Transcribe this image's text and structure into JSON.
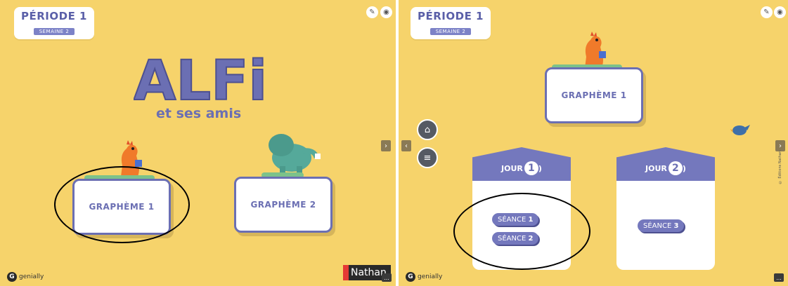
{
  "left": {
    "period_title": "PÉRIODE 1",
    "period_week": "SEMAINE 2",
    "logo_main": "ALFi",
    "logo_sub": "et ses amis",
    "card1": {
      "word": "GRAPHÈME",
      "num": "1"
    },
    "card2": {
      "word": "GRAPHÈME",
      "num": "2"
    },
    "genially": "genially",
    "publisher": "Nathan",
    "more": "...",
    "next_arrow": "›"
  },
  "right": {
    "period_title": "PÉRIODE 1",
    "period_week": "SEMAINE 2",
    "card": {
      "word": "GRAPHÈME",
      "num": "1"
    },
    "jour1": {
      "label": "JOUR",
      "num": "1",
      "suffix": ")"
    },
    "jour2": {
      "label": "JOUR",
      "num": "2",
      "suffix": ")"
    },
    "seance1": {
      "word": "SÉANCE",
      "num": "1"
    },
    "seance2": {
      "word": "SÉANCE",
      "num": "2"
    },
    "seance3": {
      "word": "SÉANCE",
      "num": "3"
    },
    "copyright": "© Éditions Nathan",
    "genially": "genially",
    "more": "...",
    "prev_arrow": "‹",
    "next_arrow": "›"
  },
  "icons": {
    "edit": "pencil-icon",
    "paint": "palette-icon",
    "home": "home-icon",
    "menu": "menu-icon"
  },
  "colors": {
    "background": "#f6d36b",
    "accent": "#6b6fb3",
    "card": "#ffffff"
  }
}
